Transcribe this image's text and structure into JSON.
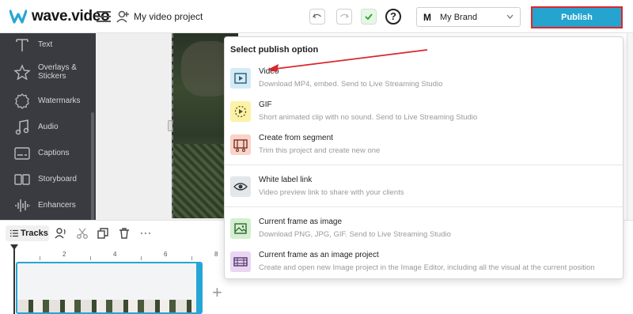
{
  "app": {
    "logo_text": "wave.video",
    "project_title": "My video project"
  },
  "toolbar": {
    "help_label": "?",
    "brand_logo": "M",
    "brand_label": "My Brand",
    "publish_label": "Publish"
  },
  "sidebar": {
    "items": [
      {
        "label": "Text",
        "icon": "text-icon"
      },
      {
        "label": "Overlays & Stickers",
        "icon": "star-icon"
      },
      {
        "label": "Watermarks",
        "icon": "watermark-icon"
      },
      {
        "label": "Audio",
        "icon": "music-note-icon"
      },
      {
        "label": "Captions",
        "icon": "captions-icon"
      },
      {
        "label": "Storyboard",
        "icon": "storyboard-icon"
      },
      {
        "label": "Enhancers",
        "icon": "waveform-icon"
      }
    ]
  },
  "timeline": {
    "tracks_label": "Tracks",
    "ruler": [
      "2",
      "4",
      "6",
      "8"
    ],
    "add_label": "+"
  },
  "publish_menu": {
    "title": "Select publish option",
    "items": [
      {
        "name": "Video",
        "desc": "Download MP4, embed. Send to Live Streaming Studio",
        "icon": "video-icon",
        "color": "#d3ebf7"
      },
      {
        "name": "GIF",
        "desc": "Short animated clip with no sound. Send to Live Streaming Studio",
        "icon": "gif-icon",
        "color": "#fbf2a6"
      },
      {
        "name": "Create from segment",
        "desc": "Trim this project and create new one",
        "icon": "segment-icon",
        "color": "#fbd2c8"
      },
      {
        "name": "White label link",
        "desc": "Video preview link to share with your clients",
        "icon": "eye-icon",
        "color": "#e3e7ea"
      },
      {
        "name": "Current frame as image",
        "desc": "Download PNG, JPG, GIF. Send to Live Streaming Studio",
        "icon": "image-icon",
        "color": "#d2f0cf"
      },
      {
        "name": "Current frame as an image project",
        "desc": "Create and open new Image project in the Image Editor, including all the visual at the current position",
        "icon": "film-icon",
        "color": "#e8d6f3"
      }
    ]
  }
}
